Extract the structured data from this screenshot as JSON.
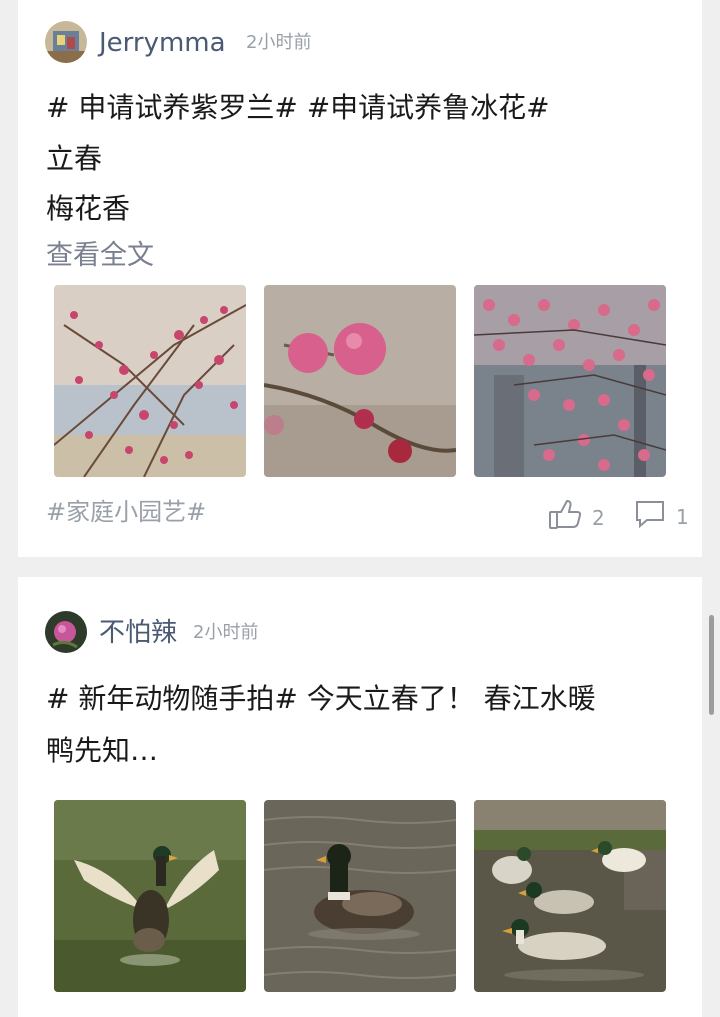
{
  "posts": [
    {
      "username": "Jerrymma",
      "time": "2小时前",
      "lines": [
        "# 申请试养紫罗兰# #申请试养鲁冰花#",
        "立春",
        "梅花香"
      ],
      "read_more": "查看全文",
      "topic": "#家庭小园艺#",
      "likes": "2",
      "comments": "1",
      "images": [
        "plum-blossom-branches-photo",
        "plum-buds-closeup-photo",
        "plum-blossom-tree-photo"
      ]
    },
    {
      "username": "不怕辣",
      "time": "2小时前",
      "lines": [
        "# 新年动物随手拍# 今天立春了！ 春江水暖",
        "鸭先知…"
      ],
      "images": [
        "duck-flapping-wings-photo",
        "duck-swimming-photo",
        "ducks-on-rocks-photo"
      ]
    }
  ],
  "colors": {
    "background": "#efefef",
    "card": "#ffffff",
    "username": "#4a5a73",
    "muted": "#9aa0a8"
  }
}
